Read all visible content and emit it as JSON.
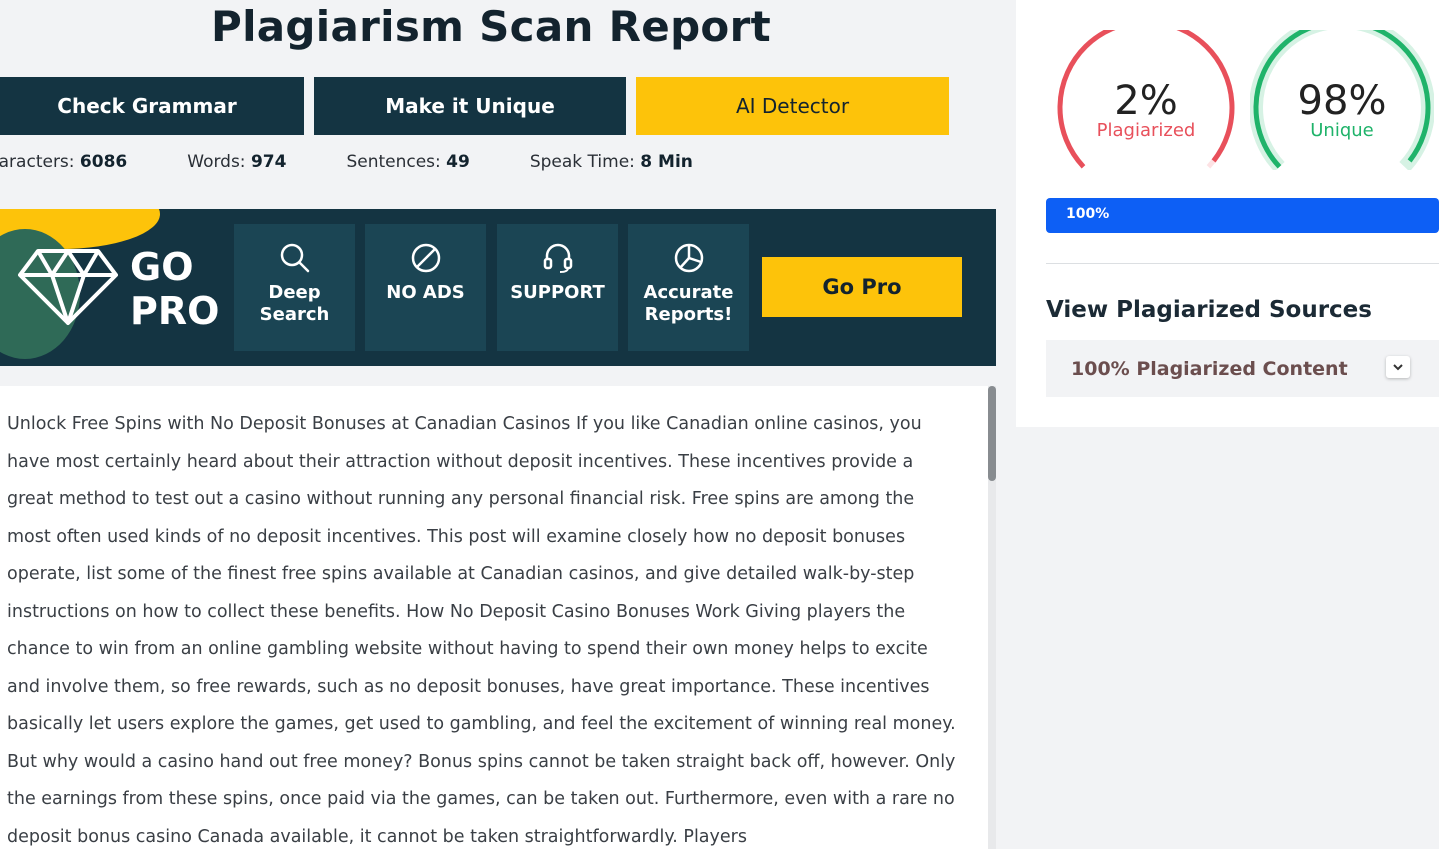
{
  "report": {
    "title": "Plagiarism Scan Report"
  },
  "actions": {
    "grammar": "Check Grammar",
    "unique": "Make it Unique",
    "ai": "AI Detector"
  },
  "stats": {
    "characters_label": "Characters:",
    "characters_value": "6086",
    "words_label": "Words:",
    "words_value": "974",
    "sentences_label": "Sentences:",
    "sentences_value": "49",
    "speak_label": "Speak Time:",
    "speak_value": "8 Min"
  },
  "promo": {
    "go": "GO",
    "pro": "PRO",
    "features": [
      "Deep Search",
      "NO ADS",
      "SUPPORT",
      "Accurate Reports!"
    ],
    "cta": "Go Pro",
    "icons": [
      "diamond-icon",
      "search-icon",
      "no-ads-icon",
      "headset-icon",
      "pie-chart-icon"
    ]
  },
  "content": {
    "text": "Unlock Free Spins with No Deposit Bonuses at Canadian Casinos If you like Canadian online casinos, you have most certainly heard about their attraction without deposit incentives. These incentives provide a great method to test out a casino without running any personal financial risk. Free spins are among the most often used kinds of no deposit incentives. This post will examine closely how no deposit bonuses operate, list some of the finest free spins available at Canadian casinos, and give detailed walk-by-step instructions on how to collect these benefits. How No Deposit Casino Bonuses Work Giving players the chance to win from an online gambling website without having to spend their own money helps to excite and involve them, so free rewards, such as no deposit bonuses, have great importance. These incentives basically let users explore the games, get used to gambling, and feel the excitement of winning real money. But why would a casino hand out free money? Bonus spins cannot be taken straight back off, however. Only the earnings from these spins, once paid via the games, can be taken out. Furthermore, even with a rare no deposit bonus casino Canada available, it cannot be taken straightforwardly. Players"
  },
  "results": {
    "plagiarized_value": "2%",
    "plagiarized_label": "Plagiarized",
    "plagiarized_fraction": 0.02,
    "unique_value": "98%",
    "unique_label": "Unique",
    "unique_fraction": 0.98,
    "progress_label": "100%",
    "progress_fraction": 1.0,
    "sources_title": "View Plagiarized Sources",
    "accordion_label": "100% Plagiarized Content"
  },
  "colors": {
    "navy": "#143442",
    "yellow": "#fdc30a",
    "red": "#e8505b",
    "green": "#1fb36a",
    "blue": "#0d5ff5"
  }
}
